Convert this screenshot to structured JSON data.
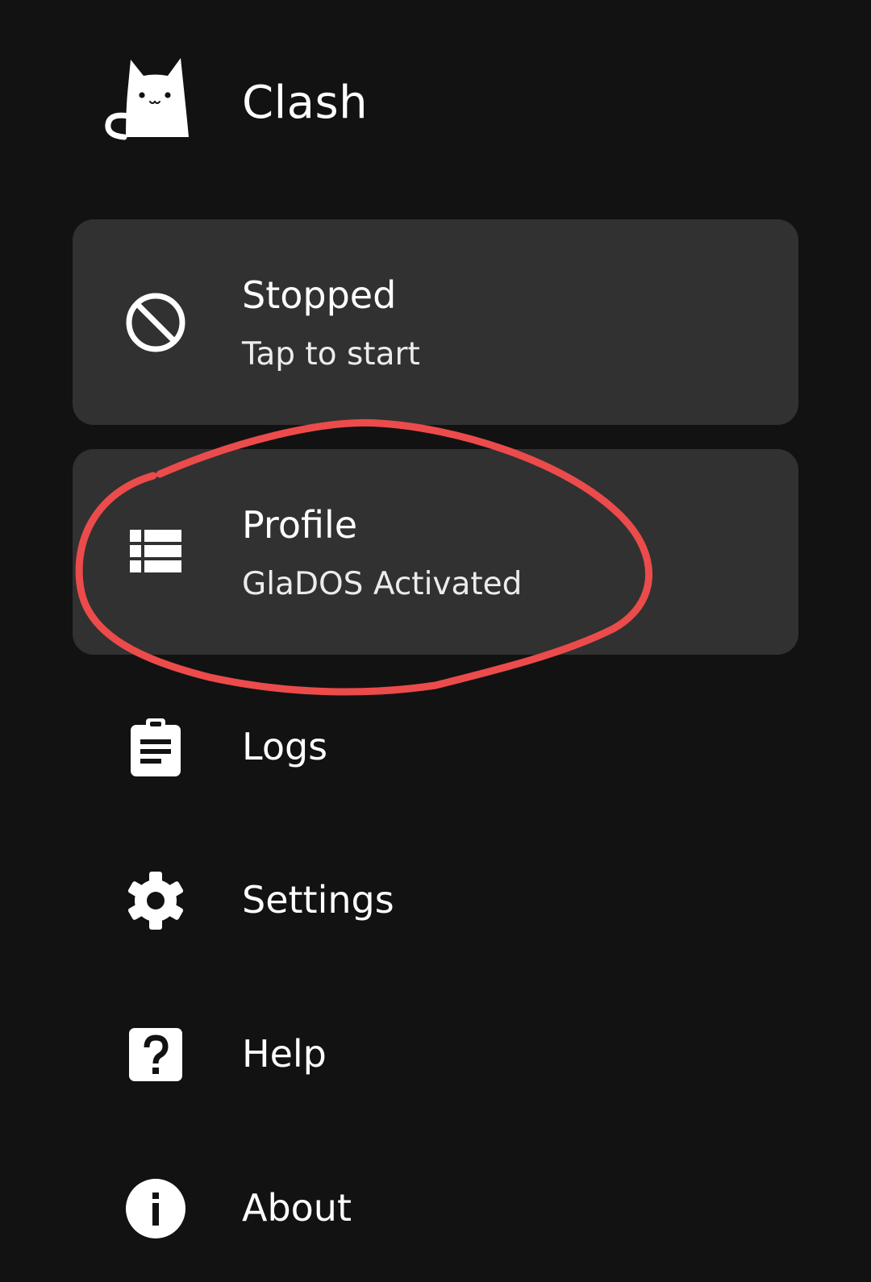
{
  "header": {
    "title": "Clash",
    "logo_icon": "cat-logo-icon"
  },
  "status_card": {
    "title": "Stopped",
    "subtitle": "Tap to start",
    "icon": "block-icon"
  },
  "profile_card": {
    "title": "Profile",
    "subtitle": "GlaDOS Activated",
    "icon": "view-list-icon"
  },
  "menu": {
    "items": [
      {
        "label": "Logs",
        "icon": "clipboard-icon"
      },
      {
        "label": "Settings",
        "icon": "gear-icon"
      },
      {
        "label": "Help",
        "icon": "help-icon"
      },
      {
        "label": "About",
        "icon": "info-icon"
      }
    ]
  },
  "colors": {
    "background": "#121212",
    "card": "#313131",
    "text": "#ffffff",
    "annotation": "#ec4b4b"
  }
}
